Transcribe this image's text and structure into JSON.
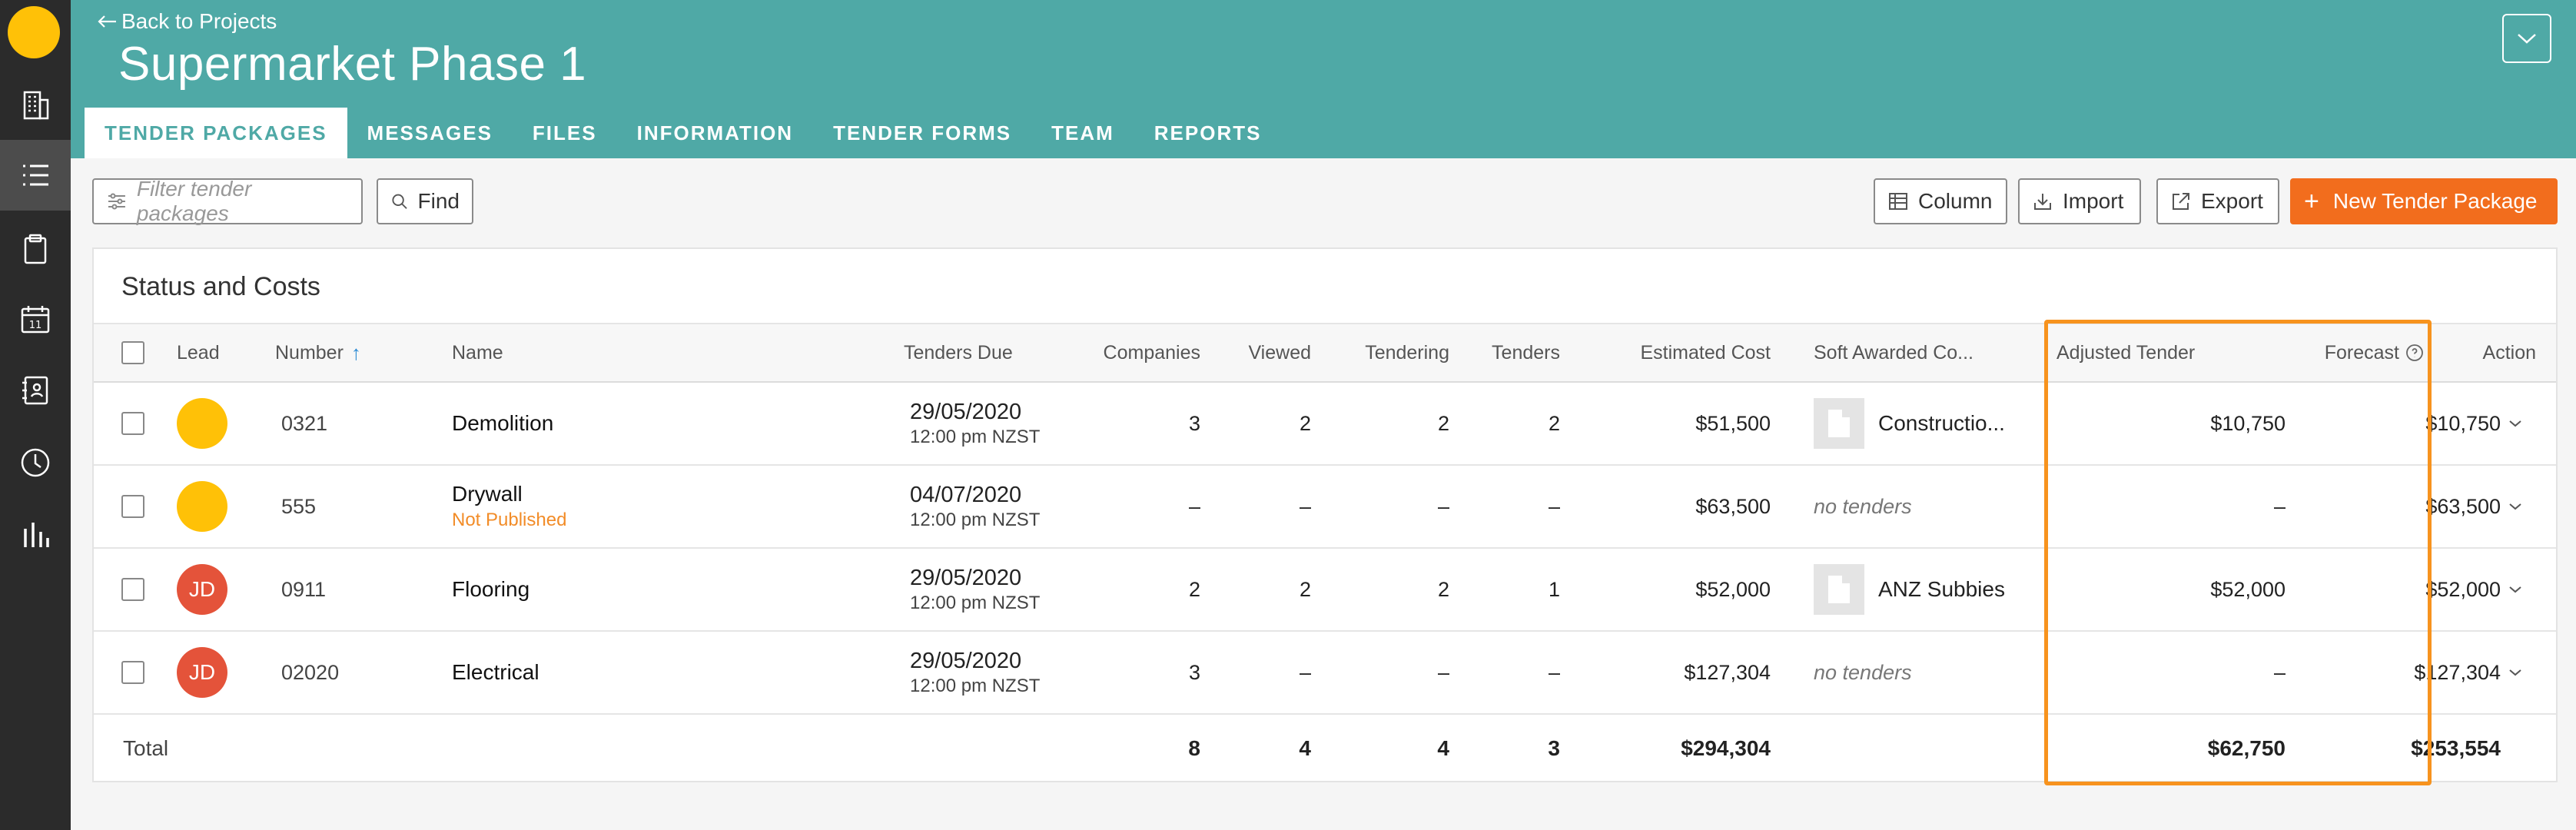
{
  "header": {
    "back_label": "Back to Projects",
    "title": "Supermarket Phase 1",
    "bg_color": "#4fa9a6"
  },
  "tabs": [
    {
      "label": "TENDER PACKAGES",
      "active": true
    },
    {
      "label": "MESSAGES"
    },
    {
      "label": "FILES"
    },
    {
      "label": "INFORMATION"
    },
    {
      "label": "TENDER FORMS"
    },
    {
      "label": "TEAM"
    },
    {
      "label": "REPORTS"
    }
  ],
  "sidebar": {
    "icons": [
      "building-icon",
      "list-icon",
      "clipboard-icon",
      "calendar-icon",
      "address-book-icon",
      "clock-icon",
      "bar-chart-icon"
    ],
    "calendar_day": "11"
  },
  "toolbar": {
    "filter_placeholder": "Filter tender packages",
    "find_label": "Find",
    "column_label": "Column",
    "import_label": "Import",
    "export_label": "Export",
    "new_label": "New Tender Package",
    "accent_color": "#f26d1d"
  },
  "card": {
    "title": "Status and Costs"
  },
  "columns": {
    "lead": "Lead",
    "number": "Number",
    "sort_arrow": "↑",
    "name": "Name",
    "due": "Tenders Due",
    "companies": "Companies",
    "viewed": "Viewed",
    "tendering": "Tendering",
    "tenders": "Tenders",
    "estimated": "Estimated Cost",
    "awarded": "Soft Awarded Co...",
    "adjusted": "Adjusted Tender",
    "forecast": "Forecast",
    "action": "Action"
  },
  "rows": [
    {
      "lead_initials": "",
      "lead_color": "#ffc107",
      "number": "0321",
      "name": "Demolition",
      "status": "",
      "due_date": "29/05/2020",
      "due_time": "12:00 pm NZST",
      "companies": "3",
      "viewed": "2",
      "tendering": "2",
      "tenders": "2",
      "estimated": "$51,500",
      "awarded": "Constructio...",
      "has_company": true,
      "adjusted": "$10,750",
      "forecast": "$10,750"
    },
    {
      "lead_initials": "",
      "lead_color": "#ffc107",
      "number": "555",
      "name": "Drywall",
      "status": "Not Published",
      "due_date": "04/07/2020",
      "due_time": "12:00 pm NZST",
      "companies": "–",
      "viewed": "–",
      "tendering": "–",
      "tenders": "–",
      "estimated": "$63,500",
      "awarded": "no tenders",
      "has_company": false,
      "adjusted": "–",
      "forecast": "$63,500"
    },
    {
      "lead_initials": "JD",
      "lead_color": "#e4533a",
      "number": "0911",
      "name": "Flooring",
      "status": "",
      "due_date": "29/05/2020",
      "due_time": "12:00 pm NZST",
      "companies": "2",
      "viewed": "2",
      "tendering": "2",
      "tenders": "1",
      "estimated": "$52,000",
      "awarded": "ANZ Subbies",
      "has_company": true,
      "adjusted": "$52,000",
      "forecast": "$52,000"
    },
    {
      "lead_initials": "JD",
      "lead_color": "#e4533a",
      "number": "02020",
      "name": "Electrical",
      "status": "",
      "due_date": "29/05/2020",
      "due_time": "12:00 pm NZST",
      "companies": "3",
      "viewed": "–",
      "tendering": "–",
      "tenders": "–",
      "estimated": "$127,304",
      "awarded": "no tenders",
      "has_company": false,
      "adjusted": "–",
      "forecast": "$127,304"
    }
  ],
  "totals": {
    "label": "Total",
    "companies": "8",
    "viewed": "4",
    "tendering": "4",
    "tenders": "3",
    "estimated": "$294,304",
    "adjusted": "$62,750",
    "forecast": "$253,554"
  },
  "highlight_color": "#f7931e"
}
